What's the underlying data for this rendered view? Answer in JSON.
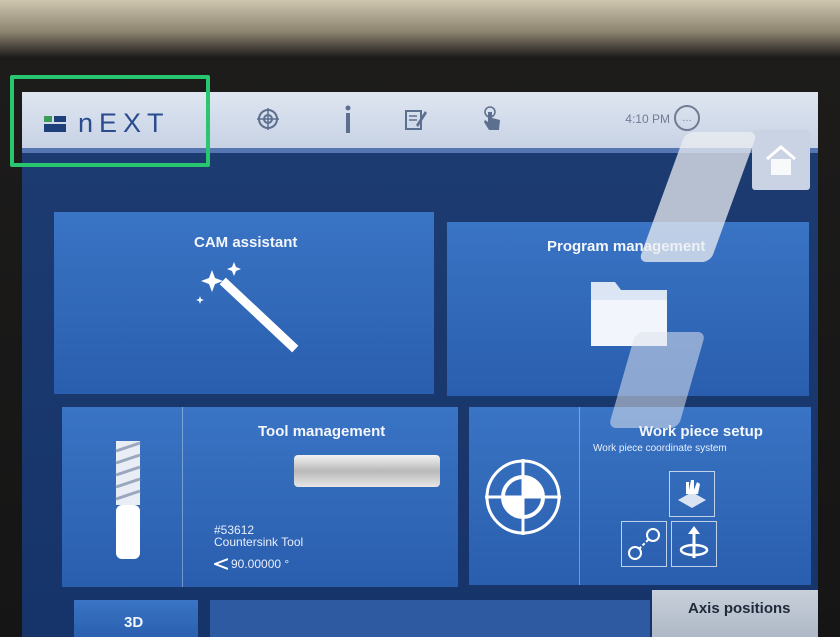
{
  "topbar": {
    "brand_name": "nEXT",
    "time": "4:10 PM",
    "icons": [
      "target-icon",
      "info-icon",
      "edit-icon",
      "touch-icon",
      "chat-icon",
      "home-icon"
    ]
  },
  "tiles": {
    "cam_assistant": {
      "title": "CAM assistant"
    },
    "program_management": {
      "title": "Program management"
    },
    "tool_management": {
      "title": "Tool management",
      "tool_number": "#53612",
      "tool_name": "Countersink Tool",
      "tool_angle": "90.00000 °"
    },
    "work_piece_setup": {
      "title": "Work piece setup",
      "subtitle": "Work piece coordinate system"
    },
    "view_3d": {
      "title": "3D"
    },
    "axis_positions": {
      "title": "Axis positions"
    }
  },
  "colors": {
    "accent": "#28c76f",
    "tile_blue": "#3a74c4",
    "topbar": "#dfe6f1"
  }
}
